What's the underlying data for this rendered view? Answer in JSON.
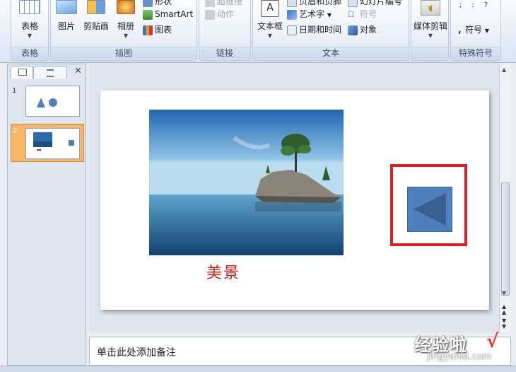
{
  "ribbon": {
    "groups": [
      {
        "label": "表格",
        "buttons": [
          {
            "label": "表格"
          }
        ]
      },
      {
        "label": "插图",
        "buttons": [
          {
            "label": "图片"
          },
          {
            "label": "剪贴画"
          },
          {
            "label": "相册"
          }
        ],
        "small": [
          {
            "label": "形状"
          },
          {
            "label": "SmartArt"
          },
          {
            "label": "图表"
          }
        ]
      },
      {
        "label": "链接",
        "small": [
          {
            "label": "超链接"
          },
          {
            "label": "动作"
          }
        ]
      },
      {
        "label": "文本",
        "buttons": [
          {
            "label": "文本框"
          }
        ],
        "small": [
          {
            "label": "页眉和页脚"
          },
          {
            "label": "艺术字"
          },
          {
            "label": "日期和时间"
          },
          {
            "label": "幻灯片编号"
          },
          {
            "label": "符号"
          },
          {
            "label": "对象"
          }
        ]
      },
      {
        "label": "媒体剪辑",
        "buttons": [
          {
            "label": "媒体剪辑"
          }
        ]
      },
      {
        "label": "特殊符号",
        "small": [
          {
            "label": "符号"
          }
        ]
      }
    ]
  },
  "outline_pane": {
    "close_glyph": "✕",
    "slides": [
      {
        "number": "1"
      },
      {
        "number": "2"
      }
    ]
  },
  "slide": {
    "caption": "美景"
  },
  "notes": {
    "placeholder": "单击此处添加备注"
  },
  "watermark": {
    "text": "经验啦",
    "url": "jingyanla.com",
    "check": "√"
  },
  "colors": {
    "accent_red": "#e21b24",
    "caption_red": "#d02020",
    "action_button_blue": "#4f80bd",
    "selected_thumb": "#f6b766"
  }
}
